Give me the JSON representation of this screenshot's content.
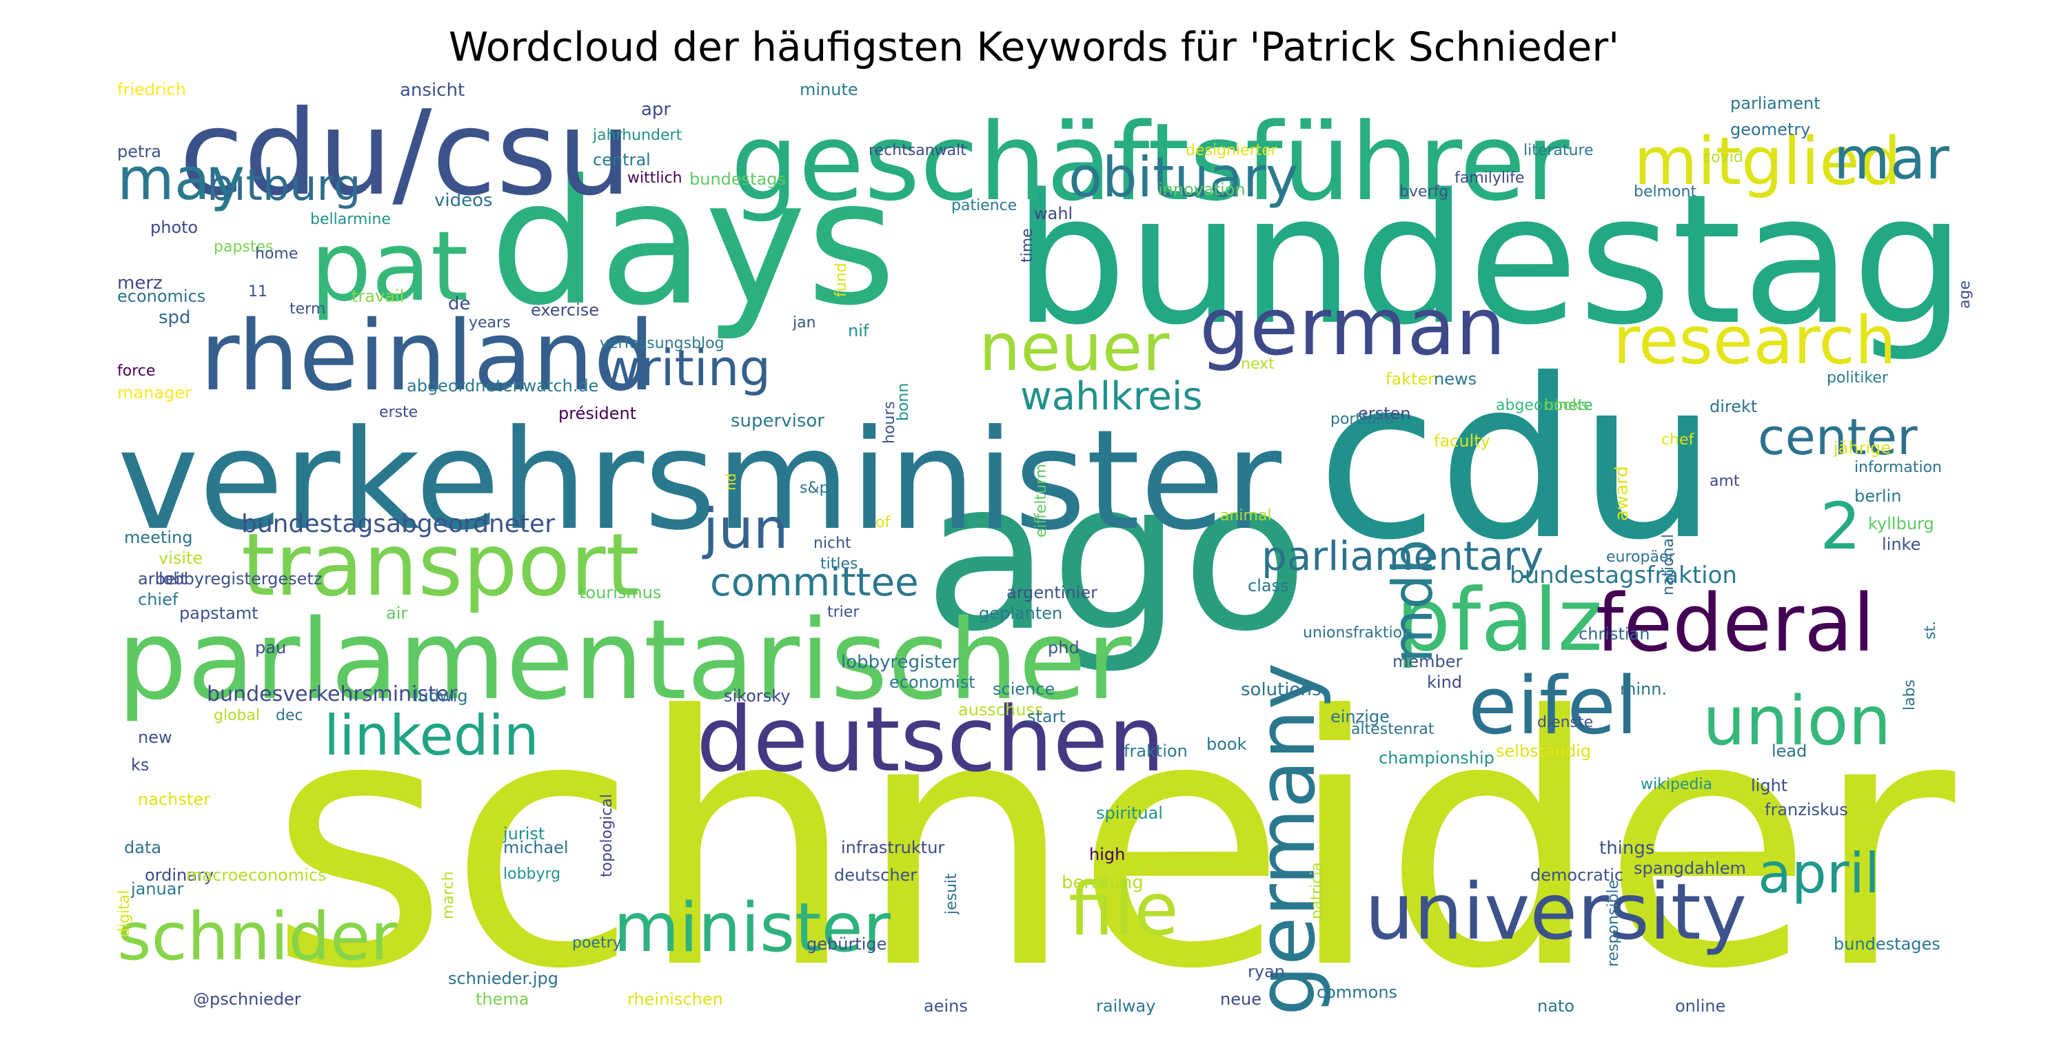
{
  "title": "Wordcloud der häufigsten Keywords für 'Patrick Schnieder'",
  "colormap": [
    "#440154",
    "#3b528b",
    "#21918c",
    "#5ec962",
    "#fde725"
  ],
  "words": [
    {
      "text": "schneider",
      "color": "#c7e020"
    },
    {
      "text": "days",
      "color": "#2cb17e"
    },
    {
      "text": "bundestag",
      "color": "#22a884"
    },
    {
      "text": "cdu",
      "color": "#21918c"
    },
    {
      "text": "ago",
      "color": "#2a9d7f"
    },
    {
      "text": "verkehrsminister",
      "color": "#2a788e"
    },
    {
      "text": "parlamentarischer",
      "color": "#5ec962"
    },
    {
      "text": "cdu/csu",
      "color": "#3b528b"
    },
    {
      "text": "geschäftsführer",
      "color": "#27ad81"
    },
    {
      "text": "rheinland",
      "color": "#355f8d"
    },
    {
      "text": "deutschen",
      "color": "#443983"
    },
    {
      "text": "german",
      "color": "#3e4989"
    },
    {
      "text": "pat",
      "color": "#35b779"
    },
    {
      "text": "transport",
      "color": "#7ad151"
    },
    {
      "text": "eifel",
      "color": "#2c728e"
    },
    {
      "text": "pfalz",
      "color": "#3dbc74"
    },
    {
      "text": "germany",
      "color": "#2a788e"
    },
    {
      "text": "federal",
      "color": "#440154"
    },
    {
      "text": "university",
      "color": "#3b528b"
    },
    {
      "text": "minister",
      "color": "#2db27d"
    },
    {
      "text": "file",
      "color": "#b5de2b"
    },
    {
      "text": "union",
      "color": "#35b779"
    },
    {
      "text": "mitglied",
      "color": "#dde318"
    },
    {
      "text": "research",
      "color": "#e5e419"
    },
    {
      "text": "neuer",
      "color": "#a0da39"
    },
    {
      "text": "schnider",
      "color": "#86d549"
    },
    {
      "text": "linkedin",
      "color": "#20a486"
    },
    {
      "text": "may",
      "color": "#2a788e"
    },
    {
      "text": "mar",
      "color": "#29798e"
    },
    {
      "text": "obituary",
      "color": "#2a788e"
    },
    {
      "text": "writing",
      "color": "#355f8d"
    },
    {
      "text": "bitburg",
      "color": "#2f6c8e"
    },
    {
      "text": "jun",
      "color": "#33638d"
    },
    {
      "text": "april",
      "color": "#1f988b"
    },
    {
      "text": "mdb",
      "color": "#287d8e"
    },
    {
      "text": "2",
      "color": "#25ab82"
    },
    {
      "text": "center",
      "color": "#2c728e"
    },
    {
      "text": "wahlkreis",
      "color": "#21918c"
    },
    {
      "text": "parliamentary",
      "color": "#2c728e"
    },
    {
      "text": "committee",
      "color": "#2a788e"
    },
    {
      "text": "bundestagsfraktion",
      "color": "#2a788e"
    },
    {
      "text": "bundestagsabgeordneter",
      "color": "#3b528b"
    },
    {
      "text": "bundesverkehrsminister",
      "color": "#3e4989"
    },
    {
      "text": "friedrich",
      "color": "#fde725"
    },
    {
      "text": "ansicht",
      "color": "#3b528b"
    },
    {
      "text": "minute",
      "color": "#287d8e"
    },
    {
      "text": "apr",
      "color": "#3e4989"
    },
    {
      "text": "jahrhundert",
      "color": "#21918c"
    },
    {
      "text": "rechtsanwalt",
      "color": "#3e4989"
    },
    {
      "text": "parliament",
      "color": "#2a788e"
    },
    {
      "text": "geometry",
      "color": "#2c728e"
    },
    {
      "text": "petra",
      "color": "#3b528b"
    },
    {
      "text": "central",
      "color": "#2a788e"
    },
    {
      "text": "wittlich",
      "color": "#440154"
    },
    {
      "text": "bundestags",
      "color": "#5ec962"
    },
    {
      "text": "designierter",
      "color": "#dde318"
    },
    {
      "text": "literature",
      "color": "#2a788e"
    },
    {
      "text": "covid",
      "color": "#b5de2b"
    },
    {
      "text": "familylife",
      "color": "#3e4989"
    },
    {
      "text": "innovation",
      "color": "#5ec962"
    },
    {
      "text": "bverfg",
      "color": "#3b528b"
    },
    {
      "text": "belmont",
      "color": "#2c728e"
    },
    {
      "text": "videos",
      "color": "#2c728e"
    },
    {
      "text": "photo",
      "color": "#3e4989"
    },
    {
      "text": "bellarmine",
      "color": "#21918c"
    },
    {
      "text": "papstes",
      "color": "#7ad151"
    },
    {
      "text": "home",
      "color": "#3b528b"
    },
    {
      "text": "merz",
      "color": "#3e4989"
    },
    {
      "text": "economics",
      "color": "#2c728e"
    },
    {
      "text": "11",
      "color": "#3b528b"
    },
    {
      "text": "travail",
      "color": "#86d549"
    },
    {
      "text": "term",
      "color": "#3b528b"
    },
    {
      "text": "spd",
      "color": "#31688e"
    },
    {
      "text": "de",
      "color": "#3e4989"
    },
    {
      "text": "exercise",
      "color": "#3e4989"
    },
    {
      "text": "years",
      "color": "#3b528b"
    },
    {
      "text": "jan",
      "color": "#3b528b"
    },
    {
      "text": "fund",
      "color": "#dde318"
    },
    {
      "text": "nif",
      "color": "#21918c"
    },
    {
      "text": "patience",
      "color": "#2a788e"
    },
    {
      "text": "wahl",
      "color": "#3e4989"
    },
    {
      "text": "time",
      "color": "#3e4989"
    },
    {
      "text": "age",
      "color": "#3b528b"
    },
    {
      "text": "verfassungsblog",
      "color": "#2a788e"
    },
    {
      "text": "force",
      "color": "#440154"
    },
    {
      "text": "manager",
      "color": "#fde725"
    },
    {
      "text": "abgeordnetenwatch.de",
      "color": "#2a788e"
    },
    {
      "text": "erste",
      "color": "#3e4989"
    },
    {
      "text": "président",
      "color": "#440154"
    },
    {
      "text": "supervisor",
      "color": "#2a788e"
    },
    {
      "text": "hours",
      "color": "#3b528b"
    },
    {
      "text": "bonn",
      "color": "#21918c"
    },
    {
      "text": "next",
      "color": "#b5de2b"
    },
    {
      "text": "fakten",
      "color": "#dde318"
    },
    {
      "text": "news",
      "color": "#2a788e"
    },
    {
      "text": "ersten",
      "color": "#3e4989"
    },
    {
      "text": "abgeordnete",
      "color": "#35b779"
    },
    {
      "text": "books",
      "color": "#7ad151"
    },
    {
      "text": "direkt",
      "color": "#2c728e"
    },
    {
      "text": "politiker",
      "color": "#2a788e"
    },
    {
      "text": "chef",
      "color": "#dde318"
    },
    {
      "text": "faculty",
      "color": "#dde318"
    },
    {
      "text": "portfolio",
      "color": "#2a788e"
    },
    {
      "text": "eiffelturm",
      "color": "#5ec962"
    },
    {
      "text": "jährige",
      "color": "#dde318"
    },
    {
      "text": "information",
      "color": "#2c728e"
    },
    {
      "text": "amt",
      "color": "#3e4989"
    },
    {
      "text": "award",
      "color": "#dde318"
    },
    {
      "text": "national",
      "color": "#31688e"
    },
    {
      "text": "berlin",
      "color": "#2a788e"
    },
    {
      "text": "kyllburg",
      "color": "#5ec962"
    },
    {
      "text": "linke",
      "color": "#3b528b"
    },
    {
      "text": "nd",
      "color": "#dde318"
    },
    {
      "text": "meeting",
      "color": "#2c728e"
    },
    {
      "text": "s&p",
      "color": "#2c728e"
    },
    {
      "text": "of",
      "color": "#dde318"
    },
    {
      "text": "animal",
      "color": "#b5de2b"
    },
    {
      "text": "nicht",
      "color": "#3b528b"
    },
    {
      "text": "europäer",
      "color": "#2c728e"
    },
    {
      "text": "visite",
      "color": "#b5de2b"
    },
    {
      "text": "titles",
      "color": "#2c728e"
    },
    {
      "text": "arbeit",
      "color": "#3e4989"
    },
    {
      "text": "lobbyregistergesetz",
      "color": "#3b528b"
    },
    {
      "text": "tourismus",
      "color": "#5ec962"
    },
    {
      "text": "argentinier",
      "color": "#3b528b"
    },
    {
      "text": "class",
      "color": "#2c728e"
    },
    {
      "text": "chief",
      "color": "#2a788e"
    },
    {
      "text": "papstamt",
      "color": "#3b528b"
    },
    {
      "text": "air",
      "color": "#5ec962"
    },
    {
      "text": "trier",
      "color": "#3b528b"
    },
    {
      "text": "geplanten",
      "color": "#2a788e"
    },
    {
      "text": "christian",
      "color": "#31688e"
    },
    {
      "text": "labs",
      "color": "#2c728e"
    },
    {
      "text": "st.",
      "color": "#2c728e"
    },
    {
      "text": "pau",
      "color": "#3e4989"
    },
    {
      "text": "phd",
      "color": "#3b528b"
    },
    {
      "text": "unionsfraktion",
      "color": "#2c728e"
    },
    {
      "text": "member",
      "color": "#3b528b"
    },
    {
      "text": "lobbyregister",
      "color": "#2c728e"
    },
    {
      "text": "science",
      "color": "#2a788e"
    },
    {
      "text": "economist",
      "color": "#2a788e"
    },
    {
      "text": "ludwig",
      "color": "#2c728e"
    },
    {
      "text": "sikorsky",
      "color": "#3e4989"
    },
    {
      "text": "ausschuss",
      "color": "#b5de2b"
    },
    {
      "text": "solutions",
      "color": "#2c728e"
    },
    {
      "text": "kind",
      "color": "#3e4989"
    },
    {
      "text": "minn.",
      "color": "#2c728e"
    },
    {
      "text": "global",
      "color": "#b5de2b"
    },
    {
      "text": "dec",
      "color": "#2c728e"
    },
    {
      "text": "start",
      "color": "#2c728e"
    },
    {
      "text": "einzige",
      "color": "#2c728e"
    },
    {
      "text": "dienste",
      "color": "#3b528b"
    },
    {
      "text": "new",
      "color": "#3b528b"
    },
    {
      "text": "fraktion",
      "color": "#2a788e"
    },
    {
      "text": "book",
      "color": "#2a788e"
    },
    {
      "text": "championship",
      "color": "#21918c"
    },
    {
      "text": "ältestenrat",
      "color": "#2c728e"
    },
    {
      "text": "selbständig",
      "color": "#dde318"
    },
    {
      "text": "lead",
      "color": "#2c728e"
    },
    {
      "text": "ks",
      "color": "#3e4989"
    },
    {
      "text": "topological",
      "color": "#3e4989"
    },
    {
      "text": "wikipedia",
      "color": "#21918c"
    },
    {
      "text": "light",
      "color": "#3e4989"
    },
    {
      "text": "nachster",
      "color": "#dde318"
    },
    {
      "text": "spiritual",
      "color": "#21918c"
    },
    {
      "text": "patricia",
      "color": "#b5de2b"
    },
    {
      "text": "responsible",
      "color": "#2c728e"
    },
    {
      "text": "franziskus",
      "color": "#3b528b"
    },
    {
      "text": "data",
      "color": "#2c728e"
    },
    {
      "text": "jurist",
      "color": "#21918c"
    },
    {
      "text": "infrastruktur",
      "color": "#3e4989"
    },
    {
      "text": "high",
      "color": "#440154"
    },
    {
      "text": "things",
      "color": "#3b528b"
    },
    {
      "text": "ordinary",
      "color": "#3e4989"
    },
    {
      "text": "macroeconomics",
      "color": "#b5de2b"
    },
    {
      "text": "michael",
      "color": "#2c728e"
    },
    {
      "text": "march",
      "color": "#b5de2b"
    },
    {
      "text": "spangdahlem",
      "color": "#3b528b"
    },
    {
      "text": "digital",
      "color": "#dde318"
    },
    {
      "text": "januar",
      "color": "#2a788e"
    },
    {
      "text": "lobbyrg",
      "color": "#21918c"
    },
    {
      "text": "deutscher",
      "color": "#3b528b"
    },
    {
      "text": "jesuit",
      "color": "#2c728e"
    },
    {
      "text": "beratung",
      "color": "#b5de2b"
    },
    {
      "text": "democratic",
      "color": "#3b528b"
    },
    {
      "text": "poetry",
      "color": "#2c728e"
    },
    {
      "text": "gebürtige",
      "color": "#3b528b"
    },
    {
      "text": "bundestages",
      "color": "#2a788e"
    },
    {
      "text": "schnieder.jpg",
      "color": "#2c728e"
    },
    {
      "text": "ryan",
      "color": "#3b528b"
    },
    {
      "text": "@pschnieder",
      "color": "#3e4989"
    },
    {
      "text": "thema",
      "color": "#7ad151"
    },
    {
      "text": "rheinischen",
      "color": "#dde318"
    },
    {
      "text": "aeins",
      "color": "#3b528b"
    },
    {
      "text": "railway",
      "color": "#2a788e"
    },
    {
      "text": "neue",
      "color": "#3e4989"
    },
    {
      "text": "commons",
      "color": "#2c728e"
    },
    {
      "text": "nato",
      "color": "#2c728e"
    },
    {
      "text": "online",
      "color": "#3b528b"
    }
  ]
}
